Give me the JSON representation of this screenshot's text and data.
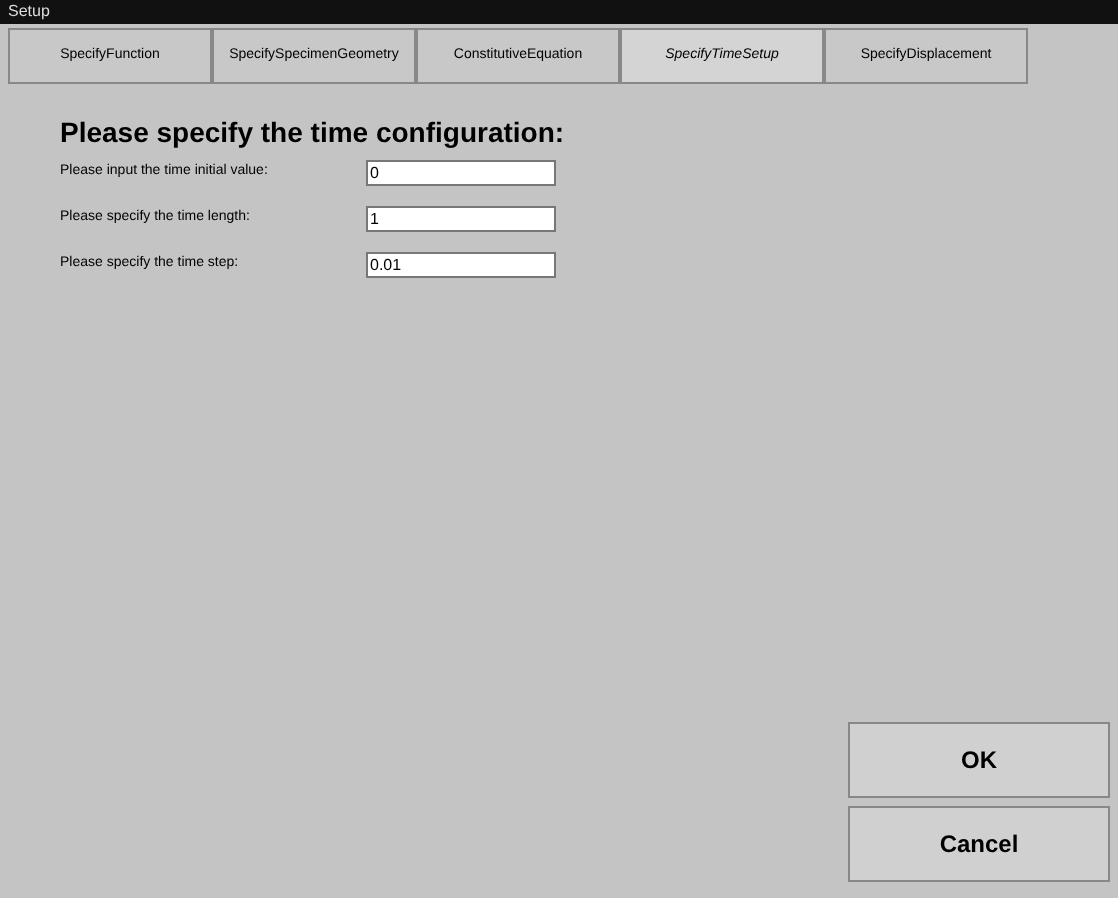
{
  "window": {
    "title": "Setup"
  },
  "tabs": [
    {
      "label": "SpecifyFunction",
      "selected": false
    },
    {
      "label": "SpecifySpecimenGeometry",
      "selected": false
    },
    {
      "label": "ConstitutiveEquation",
      "selected": false
    },
    {
      "label": "SpecifyTimeSetup",
      "selected": true
    },
    {
      "label": "SpecifyDisplacement",
      "selected": false
    }
  ],
  "heading": "Please specify the time configuration:",
  "fields": [
    {
      "label": "Please input the time initial value:",
      "value": "0"
    },
    {
      "label": "Please specify the time length:",
      "value": "1"
    },
    {
      "label": "Please specify the time step:",
      "value": "0.01"
    }
  ],
  "buttons": [
    "OK",
    "Cancel"
  ]
}
